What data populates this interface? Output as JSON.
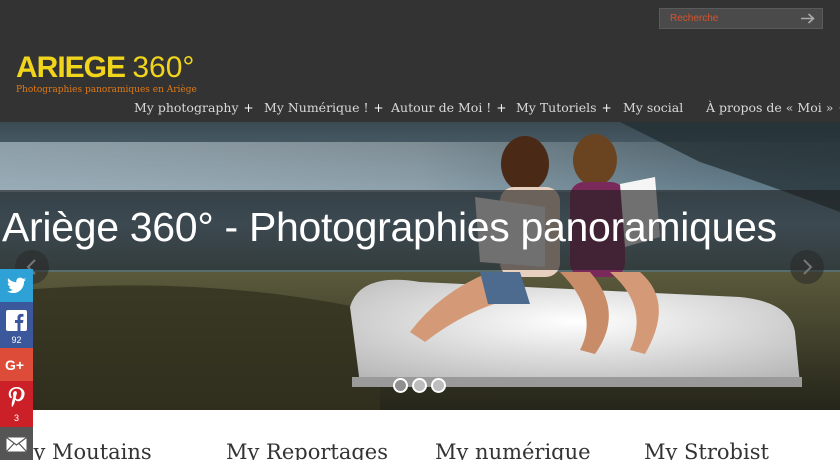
{
  "search": {
    "placeholder": "Recherche"
  },
  "logo": {
    "main": "ARIEGE",
    "number": "360°",
    "tagline": "Photographies panoramiques en Ariège"
  },
  "nav": [
    {
      "label": "My photography",
      "has_submenu": true,
      "submenu_marker": "+"
    },
    {
      "label": "My Numérique !",
      "has_submenu": true,
      "submenu_marker": "+"
    },
    {
      "label": "Autour de Moi !",
      "has_submenu": true,
      "submenu_marker": "+"
    },
    {
      "label": "My Tutoriels",
      "has_submenu": true,
      "submenu_marker": "+"
    },
    {
      "label": "My social",
      "has_submenu": false,
      "submenu_marker": ""
    },
    {
      "label": "À propos de « Moi »",
      "has_submenu": true,
      "submenu_marker": "+"
    }
  ],
  "hero": {
    "title": "Ariège 360° - Photographies panoramiques",
    "slide_count": 3,
    "active_slide": 1
  },
  "sections": [
    {
      "heading": "My Moutains"
    },
    {
      "heading": "My Reportages"
    },
    {
      "heading": "My numérique"
    },
    {
      "heading": "My Strobist"
    }
  ],
  "share": {
    "twitter": {
      "icon": "twitter-bird-icon",
      "color": "#2ea2d7",
      "count": ""
    },
    "facebook": {
      "icon": "facebook-f-icon",
      "color": "#3a589b",
      "count": "92"
    },
    "googleplus": {
      "icon": "google-plus-icon",
      "color": "#dd4b39",
      "count": ""
    },
    "pinterest": {
      "icon": "pinterest-p-icon",
      "color": "#cb2027",
      "count": "3"
    },
    "email": {
      "icon": "envelope-icon",
      "color": "#555555",
      "count": ""
    }
  },
  "colors": {
    "header_bg": "#333333",
    "logo_yellow": "#f0d51c",
    "tagline_orange": "#e07a14",
    "nav_text": "#d9d9d9"
  }
}
